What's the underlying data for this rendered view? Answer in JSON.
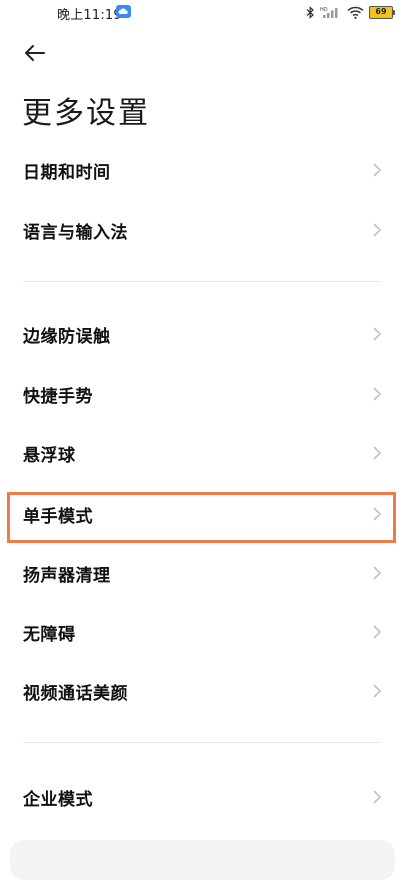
{
  "status_bar": {
    "time": "晚上11:19",
    "battery": "69",
    "icons": [
      "cloud-icon",
      "bluetooth-icon",
      "signal-icon",
      "wifi-icon",
      "battery-icon"
    ]
  },
  "header": {
    "title": "更多设置"
  },
  "groups": [
    {
      "items": [
        {
          "label": "日期和时间"
        },
        {
          "label": "语言与输入法"
        }
      ]
    },
    {
      "items": [
        {
          "label": "边缘防误触"
        },
        {
          "label": "快捷手势"
        },
        {
          "label": "悬浮球"
        },
        {
          "label": "单手模式"
        },
        {
          "label": "扬声器清理"
        },
        {
          "label": "无障碍"
        },
        {
          "label": "视频通话美颜"
        }
      ]
    },
    {
      "items": [
        {
          "label": "企业模式"
        }
      ]
    }
  ],
  "highlighted_item": "单手模式",
  "colors": {
    "highlight": "#f47a45",
    "battery": "#f0c419",
    "cloud": "#3b8bef"
  }
}
